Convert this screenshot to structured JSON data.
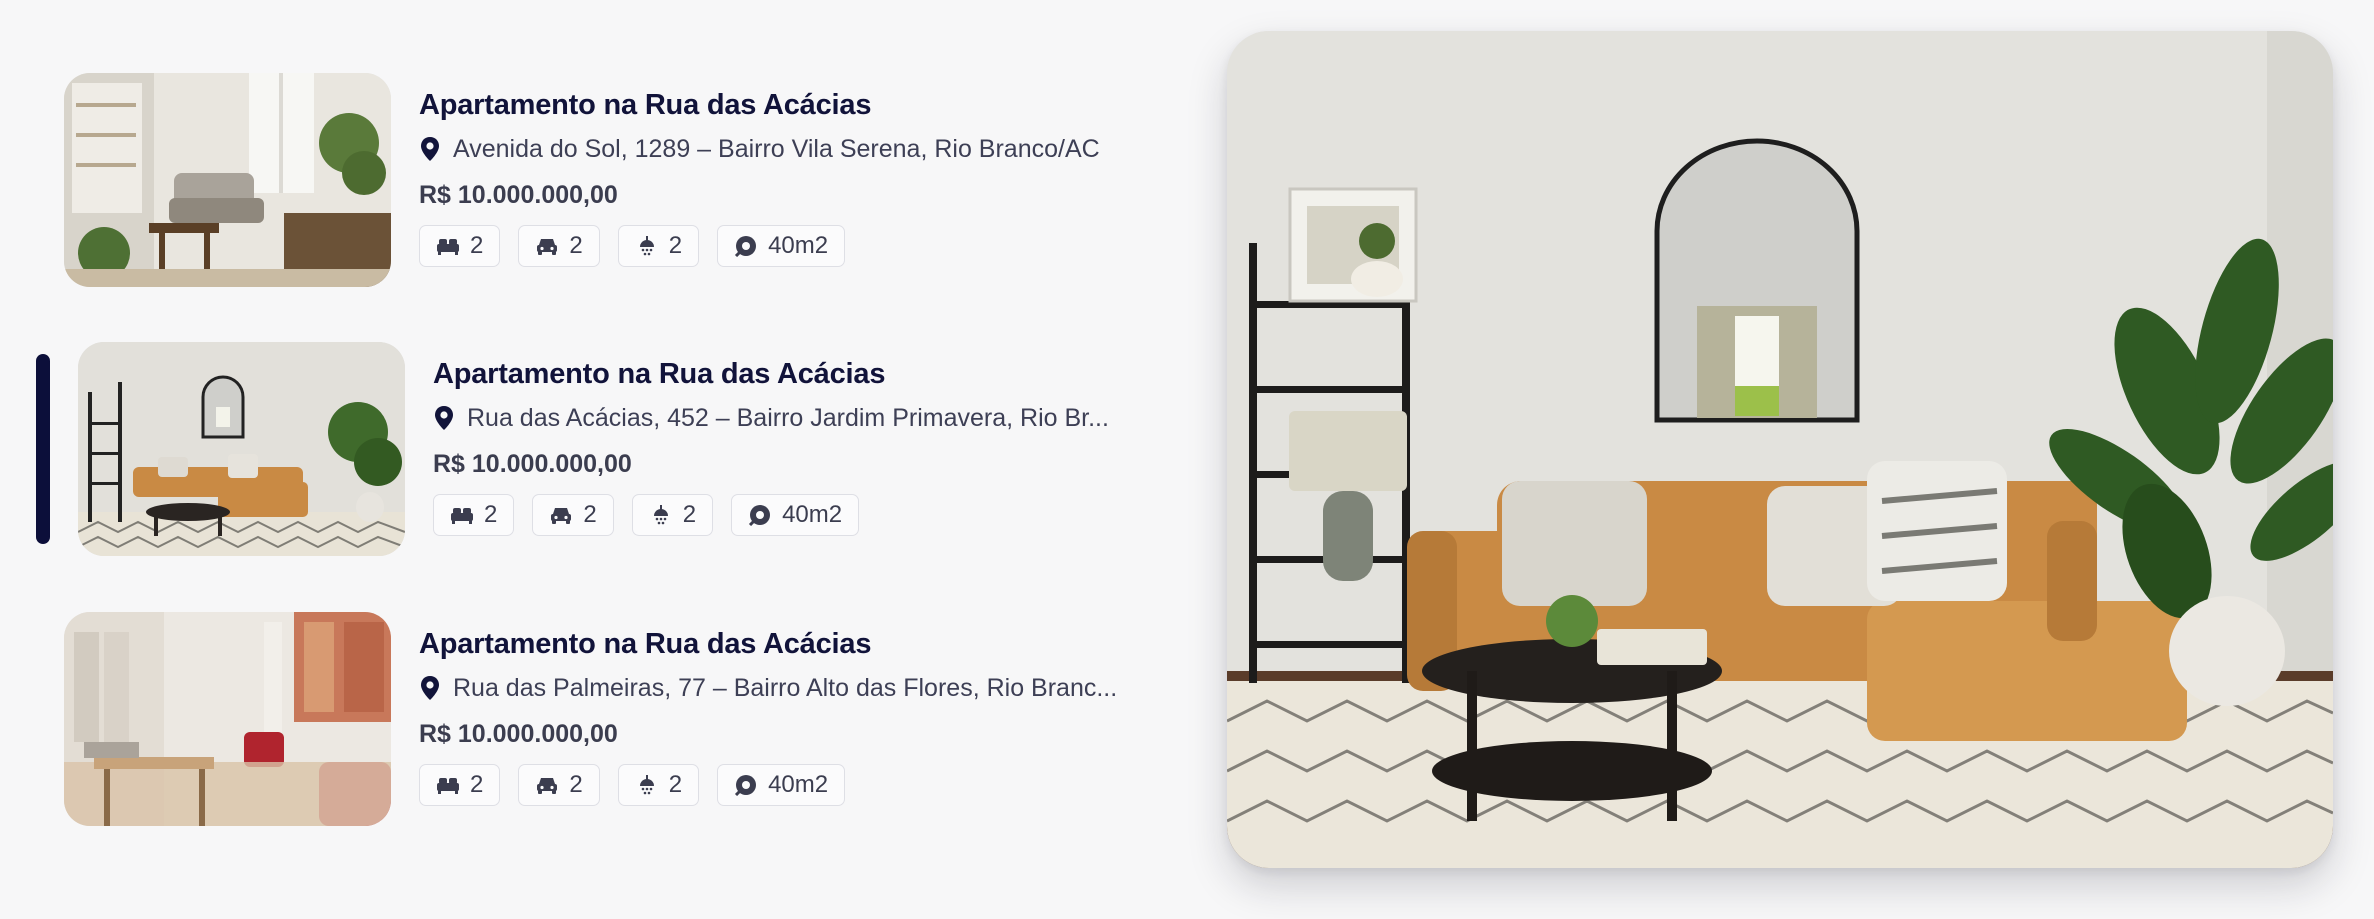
{
  "listings": [
    {
      "title": "Apartamento na Rua das Acácias",
      "address": "Avenida do Sol, 1289 – Bairro Vila Serena, Rio Branco/AC",
      "price": "R$ 10.000.000,00",
      "bedrooms": "2",
      "parking": "2",
      "bathrooms": "2",
      "area": "40m2",
      "selected": false
    },
    {
      "title": "Apartamento na Rua das Acácias",
      "address": "Rua das Acácias, 452 – Bairro Jardim Primavera, Rio Br...",
      "price": "R$ 10.000.000,00",
      "bedrooms": "2",
      "parking": "2",
      "bathrooms": "2",
      "area": "40m2",
      "selected": true
    },
    {
      "title": "Apartamento na Rua das Acácias",
      "address": "Rua das Palmeiras, 77 – Bairro Alto das Flores, Rio Branc...",
      "price": "R$ 10.000.000,00",
      "bedrooms": "2",
      "parking": "2",
      "bathrooms": "2",
      "area": "40m2",
      "selected": false
    }
  ],
  "icons": {
    "address": "location-pin-icon",
    "bedrooms": "bed-icon",
    "parking": "car-icon",
    "bathrooms": "shower-icon",
    "area": "area-icon"
  },
  "colors": {
    "background": "#f7f7f8",
    "title": "#11133a",
    "selected_indicator": "#0c0f3a",
    "text_muted": "#3d3f55"
  }
}
